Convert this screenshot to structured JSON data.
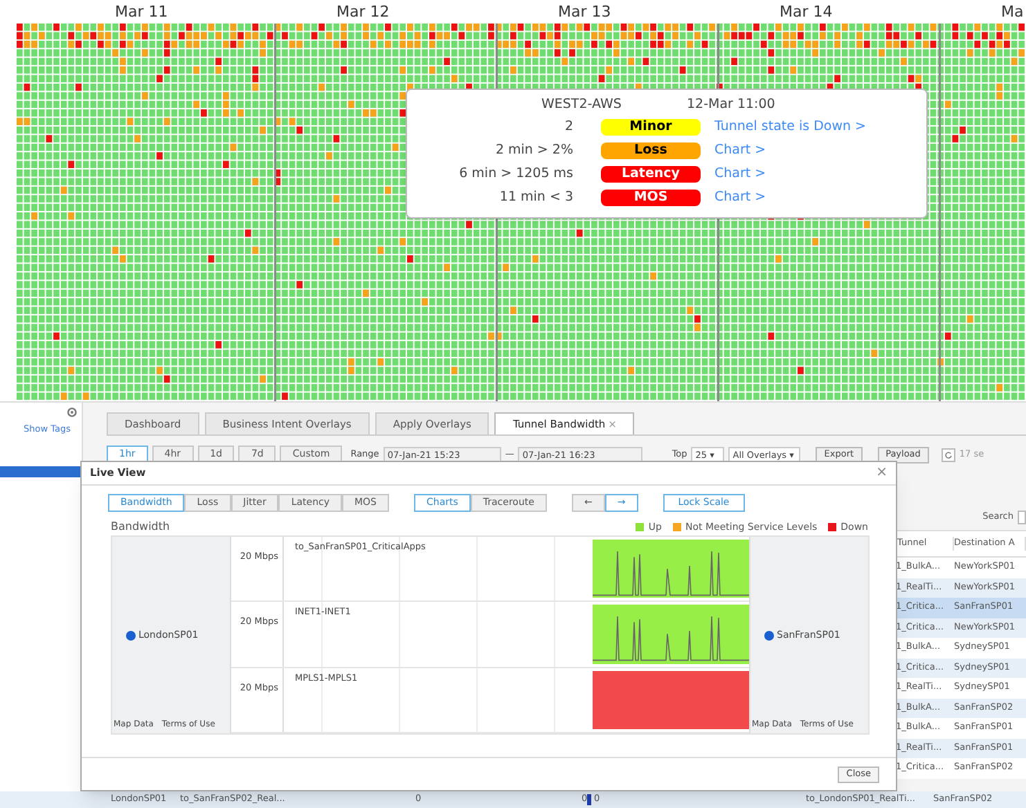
{
  "timeline": {
    "dates": [
      "Mar 11",
      "Mar 12",
      "Mar 13",
      "Mar 14",
      "Ma"
    ]
  },
  "tooltip": {
    "site": "WEST2-AWS",
    "time": "12-Mar 11:00",
    "rows": [
      {
        "value": "2",
        "badge": "Minor",
        "color": "#ffff00",
        "link": "Tunnel state is Down >"
      },
      {
        "value": "2 min > 2%",
        "badge": "Loss",
        "color": "#ffa500",
        "link": "Chart >"
      },
      {
        "value": "6 min > 1205 ms",
        "badge": "Latency",
        "color": "#ff0000",
        "link": "Chart >"
      },
      {
        "value": "11 min < 3",
        "badge": "MOS",
        "color": "#ff0000",
        "link": "Chart >"
      }
    ]
  },
  "sidebar": {
    "show_tags": "Show Tags"
  },
  "tabs": [
    {
      "label": "Dashboard",
      "selected": false
    },
    {
      "label": "Business Intent Overlays",
      "selected": false
    },
    {
      "label": "Apply Overlays",
      "selected": false
    },
    {
      "label": "Tunnel Bandwidth",
      "selected": true,
      "close": "×"
    }
  ],
  "toolbar": {
    "ranges": [
      {
        "label": "1hr",
        "selected": true
      },
      {
        "label": "4hr",
        "selected": false
      },
      {
        "label": "1d",
        "selected": false
      },
      {
        "label": "7d",
        "selected": false
      },
      {
        "label": "Custom",
        "selected": false
      }
    ],
    "range_label": "Range",
    "from": "07-Jan-21 15:23",
    "dash": "—",
    "to": "07-Jan-21 16:23",
    "top_label": "Top",
    "top_value": "25",
    "overlay_value": "All Overlays",
    "caret": "▾",
    "buttons": [
      "Export",
      "Payload"
    ],
    "cut_text": "17 se"
  },
  "table": {
    "search_label": "Search",
    "columns": [
      "Tunnel",
      "Destination A"
    ],
    "rows": [
      {
        "tunnel": "1_BulkA...",
        "destination": "NewYorkSP01",
        "selected": false
      },
      {
        "tunnel": "1_RealTi...",
        "destination": "NewYorkSP01",
        "selected": false
      },
      {
        "tunnel": "1_Critica...",
        "destination": "SanFranSP01",
        "selected": true
      },
      {
        "tunnel": "1_Critica...",
        "destination": "NewYorkSP01",
        "selected": false
      },
      {
        "tunnel": "1_BulkA...",
        "destination": "SydneySP01",
        "selected": false
      },
      {
        "tunnel": "1_Critica...",
        "destination": "SydneySP01",
        "selected": false
      },
      {
        "tunnel": "1_RealTi...",
        "destination": "SydneySP01",
        "selected": false
      },
      {
        "tunnel": "1_BulkA...",
        "destination": "SanFranSP02",
        "selected": false
      },
      {
        "tunnel": "1_BulkA...",
        "destination": "SanFranSP01",
        "selected": false
      },
      {
        "tunnel": "1_RealTi...",
        "destination": "SanFranSP01",
        "selected": false
      },
      {
        "tunnel": "1_Critica...",
        "destination": "SanFranSP02",
        "selected": false
      }
    ],
    "last_row": {
      "source": "LondonSP01",
      "overlay": "to_SanFranSP02_Real...",
      "count_1": "0",
      "count_2": "0",
      "count_3": "0",
      "tunnel": "to_LondonSP01_RealTi...",
      "destination": "SanFranSP02"
    }
  },
  "live_view": {
    "title": "Live View",
    "close": "×",
    "metric_tabs": [
      {
        "label": "Bandwidth",
        "selected": true
      },
      {
        "label": "Loss",
        "selected": false
      },
      {
        "label": "Jitter",
        "selected": false
      },
      {
        "label": "Latency",
        "selected": false
      },
      {
        "label": "MOS",
        "selected": false
      }
    ],
    "view_tabs": [
      {
        "label": "Charts",
        "selected": true
      },
      {
        "label": "Traceroute",
        "selected": false
      }
    ],
    "nav": [
      {
        "label": "←",
        "selected": false
      },
      {
        "label": "→",
        "selected": true
      }
    ],
    "lock_scale": "Lock Scale",
    "section_title": "Bandwidth",
    "legend": [
      {
        "label": "Up",
        "color": "#8ee03a"
      },
      {
        "label": "Not Meeting Service Levels",
        "color": "#f5a623"
      },
      {
        "label": "Down",
        "color": "#e8141b"
      }
    ],
    "source": {
      "site": "LondonSP01",
      "map_data": "Map Data",
      "terms": "Terms of Use"
    },
    "destination": {
      "site": "SanFranSP01",
      "map_data": "Map Data",
      "terms": "Terms of Use"
    },
    "tunnels": [
      {
        "name": "to_SanFranSP01_CriticalApps",
        "scale": "20 Mbps",
        "color": "#97ee47"
      },
      {
        "name": "INET1-INET1",
        "scale": "20 Mbps",
        "color": "#97ee47"
      },
      {
        "name": "MPLS1-MPLS1",
        "scale": "20 Mbps",
        "color": "#f24a4a"
      }
    ],
    "close_button": "Close"
  }
}
